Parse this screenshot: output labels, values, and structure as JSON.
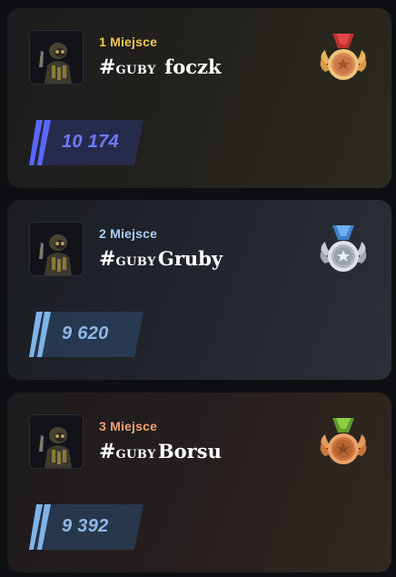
{
  "leaderboard": {
    "entries": [
      {
        "place_label": "1 Miejsce",
        "hash": "#",
        "tag": "GUBY",
        "name": "foczk",
        "score": "10 174",
        "medal": "gold-medal-icon"
      },
      {
        "place_label": "2 Miejsce",
        "hash": "#",
        "tag": "GUBY",
        "name": "Gruby",
        "score": "9 620",
        "medal": "silver-medal-icon"
      },
      {
        "place_label": "3 Miejsce",
        "hash": "#",
        "tag": "GUBY",
        "name": "Borsu",
        "score": "9 392",
        "medal": "bronze-medal-icon"
      }
    ]
  },
  "colors": {
    "gold": "#f0c850",
    "silver": "#a9cdf3",
    "bronze": "#f1a173",
    "score_gold": "#6f7bff",
    "score_other": "#8fb8e6"
  }
}
